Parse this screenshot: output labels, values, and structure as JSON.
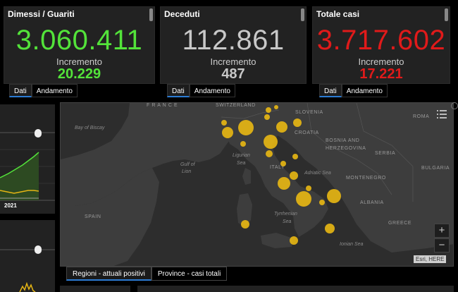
{
  "cards": [
    {
      "title": "Dimessi / Guariti",
      "value": "3.060.411",
      "increment_label": "Incremento",
      "increment": "20.229",
      "value_color": "#53e33a",
      "increment_color": "#53e33a"
    },
    {
      "title": "Deceduti",
      "value": "112.861",
      "increment_label": "Incremento",
      "increment": "487",
      "value_color": "#c8c8c8",
      "increment_color": "#c8c8c8"
    },
    {
      "title": "Totale casi",
      "value": "3.717.602",
      "increment_label": "Incremento",
      "increment": "17.221",
      "value_color": "#e01a1a",
      "increment_color": "#e01a1a"
    }
  ],
  "card_tabs": {
    "tab1": "Dati",
    "tab2": "Andamento"
  },
  "left_panel": {
    "year_label": "2021"
  },
  "map": {
    "labels": {
      "france": "F R A N C E",
      "switzerland": "SWITZERLAND",
      "slovenia": "SLOVENIA",
      "croatia": "CROATIA",
      "bosnia": "BOSNIA AND",
      "herzegovina": "HERZEGOVINA",
      "serbia": "SERBIA",
      "romania": "ROMA",
      "bulgaria": "BULGARIA",
      "montenegro": "MONTENEGRO",
      "albania": "ALBANIA",
      "greece": "GREECE",
      "spain": "SPAIN",
      "italy": "ITALY",
      "bay_of_biscay": "Bay of Biscay",
      "gulf_of_lion_1": "Gulf of",
      "gulf_of_lion_2": "Lion",
      "ligurian_1": "Ligurian",
      "ligurian_2": "Sea",
      "adriatic": "Adriatic Sea",
      "tyrrhenian_1": "Tyrrhenian",
      "tyrrhenian_2": "Sea",
      "ionian": "Ionian Sea"
    },
    "bubble_color": "#e5b514",
    "attribution": "Esri, HERE",
    "zoom_in": "+",
    "zoom_out": "−"
  },
  "bottom_tabs": {
    "tab1": "Regioni - attuali positivi",
    "tab2": "Province - casi totali"
  }
}
